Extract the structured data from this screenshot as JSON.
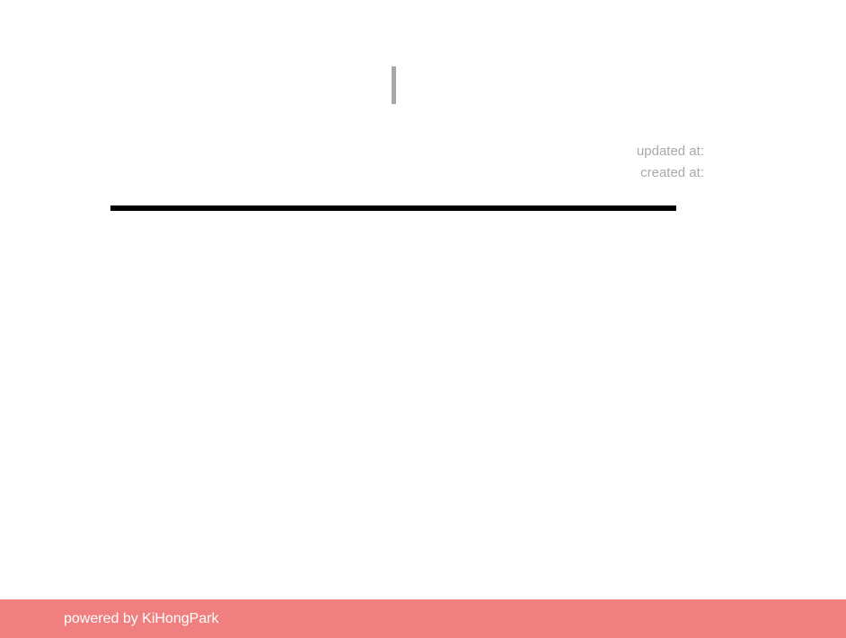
{
  "post": {
    "title": "",
    "updated_label": "updated at:",
    "updated_value": "",
    "created_label": "created at:",
    "created_value": "",
    "body": ""
  },
  "footer": {
    "text": "powered by KiHongPark"
  },
  "colors": {
    "footer_background": "#f08080",
    "title_accent": "#a8a8a8",
    "meta_text": "#a9a9a9",
    "divider": "#000000"
  }
}
